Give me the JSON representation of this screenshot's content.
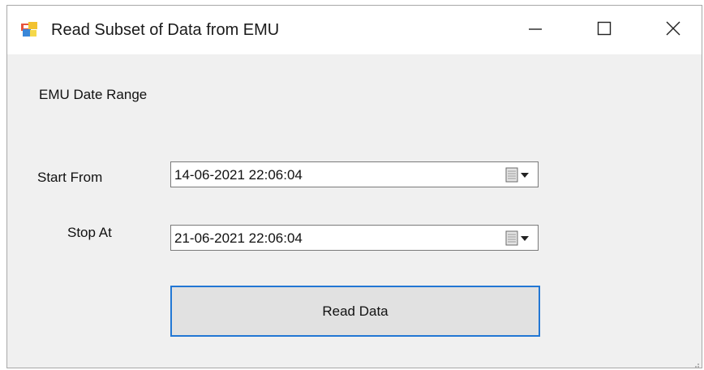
{
  "window": {
    "title": "Read Subset of Data from EMU",
    "app_icon": "windows-form-icon",
    "controls": {
      "minimize_icon": "minimize-icon",
      "maximize_icon": "maximize-icon",
      "close_icon": "close-icon"
    }
  },
  "form": {
    "section_label": "EMU Date Range",
    "start": {
      "label": "Start From",
      "value": "14-06-2021 22:06:04",
      "dropdown_icon": "calendar-dropdown-icon"
    },
    "stop": {
      "label": "Stop At",
      "value": "21-06-2021 22:06:04",
      "dropdown_icon": "calendar-dropdown-icon"
    },
    "read_button_label": "Read Data"
  },
  "colors": {
    "accent_focus": "#2277d4",
    "window_bg": "#f0f0f0",
    "button_bg": "#e1e1e1"
  }
}
